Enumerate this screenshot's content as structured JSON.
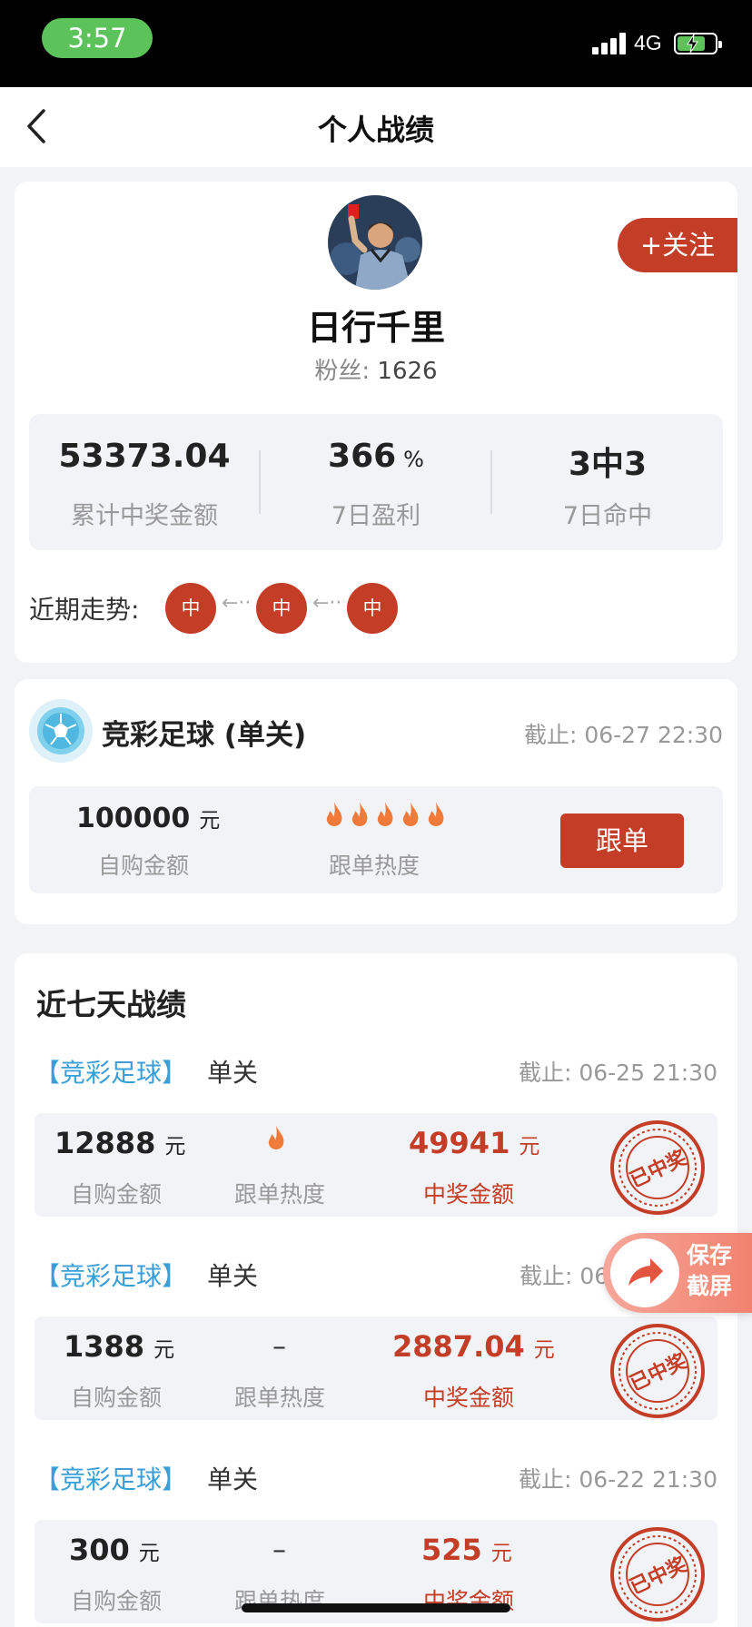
{
  "status_bar": {
    "time": "3:57",
    "network": "4G"
  },
  "nav": {
    "title": "个人战绩"
  },
  "profile": {
    "name": "日行千里",
    "fans_label": "粉丝:",
    "fans_count": "1626",
    "follow_label": "+关注",
    "stats": [
      {
        "value": "53373.04",
        "unit": "",
        "label": "累计中奖金额"
      },
      {
        "value": "366",
        "unit": "%",
        "label": "7日盈利"
      },
      {
        "value": "3中3",
        "unit": "",
        "label": "7日命中"
      }
    ],
    "trend_label": "近期走势:",
    "trend": [
      "中",
      "中",
      "中"
    ]
  },
  "current_bet": {
    "title": "竞彩足球 (单关)",
    "deadline": "截止: 06-27 22:30",
    "amount": "100000",
    "amount_unit": "元",
    "amount_label": "自购金额",
    "heat_label": "跟单热度",
    "heat_level": 5,
    "follow_button": "跟单"
  },
  "history": {
    "title": "近七天战绩",
    "records": [
      {
        "tag": "【竞彩足球】",
        "type": "单关",
        "deadline": "截止: 06-25 21:30",
        "amount": "12888",
        "unit": "元",
        "amount_label": "自购金额",
        "heat_label": "跟单热度",
        "heat": "flame",
        "win": "49941",
        "win_unit": "元",
        "win_label": "中奖金额",
        "stamp": "已中奖"
      },
      {
        "tag": "【竞彩足球】",
        "type": "单关",
        "deadline": "截止: 06",
        "amount": "1388",
        "unit": "元",
        "amount_label": "自购金额",
        "heat_label": "跟单热度",
        "heat": "–",
        "win": "2887.04",
        "win_unit": "元",
        "win_label": "中奖金额",
        "stamp": "已中奖"
      },
      {
        "tag": "【竞彩足球】",
        "type": "单关",
        "deadline": "截止: 06-22 21:30",
        "amount": "300",
        "unit": "元",
        "amount_label": "自购金额",
        "heat_label": "跟单热度",
        "heat": "–",
        "win": "525",
        "win_unit": "元",
        "win_label": "中奖金额",
        "stamp": "已中奖"
      }
    ]
  },
  "save_float": {
    "line1": "保存",
    "line2": "截屏"
  },
  "colors": {
    "accent": "#c43d27",
    "tag_blue": "#3a9fd8",
    "card_bg": "#f2f3f7"
  }
}
